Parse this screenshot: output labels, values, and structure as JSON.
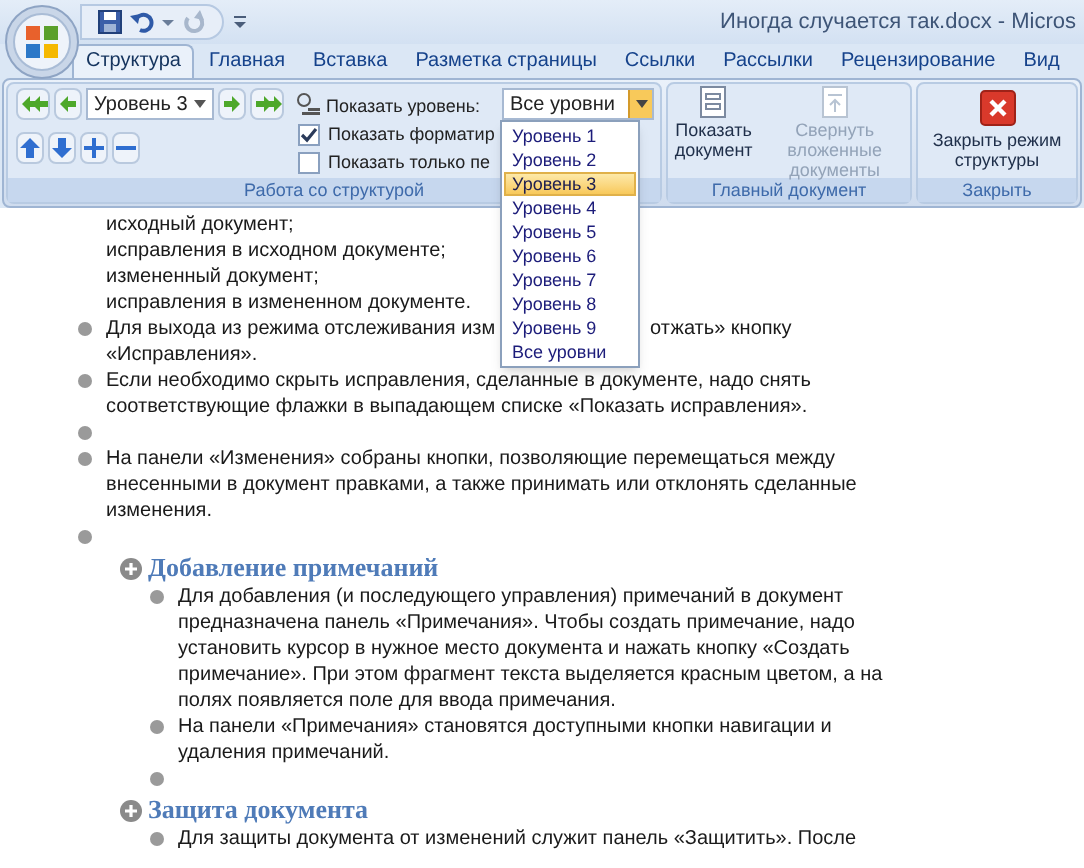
{
  "window": {
    "title": "Иногда случается так.docx - Micros"
  },
  "tabs": [
    {
      "label": "Структура",
      "selected": true
    },
    {
      "label": "Главная",
      "selected": false
    },
    {
      "label": "Вставка",
      "selected": false
    },
    {
      "label": "Разметка страницы",
      "selected": false
    },
    {
      "label": "Ссылки",
      "selected": false
    },
    {
      "label": "Рассылки",
      "selected": false
    },
    {
      "label": "Рецензирование",
      "selected": false
    },
    {
      "label": "Вид",
      "selected": false
    }
  ],
  "outline_group": {
    "label": "Работа со структурой",
    "level_combo": "Уровень 3",
    "show_level_label": "Показать уровень:",
    "show_level_combo": "Все уровни",
    "dropdown_open": true,
    "checkboxes": [
      {
        "label": "Показать форматир",
        "checked": true
      },
      {
        "label": "Показать только пе",
        "checked": false
      }
    ],
    "levels": [
      {
        "label": "Уровень 1",
        "selected": false
      },
      {
        "label": "Уровень 2",
        "selected": false
      },
      {
        "label": "Уровень 3",
        "selected": true
      },
      {
        "label": "Уровень 4",
        "selected": false
      },
      {
        "label": "Уровень 5",
        "selected": false
      },
      {
        "label": "Уровень 6",
        "selected": false
      },
      {
        "label": "Уровень 7",
        "selected": false
      },
      {
        "label": "Уровень 8",
        "selected": false
      },
      {
        "label": "Уровень 9",
        "selected": false
      },
      {
        "label": "Все уровни",
        "selected": false
      }
    ]
  },
  "master_group": {
    "label": "Главный документ",
    "buttons": [
      {
        "label": "Показать документ",
        "disabled": false
      },
      {
        "label": "Свернуть вложенные документы",
        "disabled": true
      }
    ]
  },
  "close_group": {
    "label": "Закрыть",
    "button": "Закрыть режим структуры"
  },
  "document": [
    {
      "kind": "plain",
      "text": "исходный документ;"
    },
    {
      "kind": "plain",
      "text": "исправления в исходном документе;"
    },
    {
      "kind": "plain",
      "text": "измененный документ;"
    },
    {
      "kind": "plain",
      "text": "исправления в измененном документе."
    },
    {
      "kind": "covered",
      "text_left": "Для выхода из режима отслеживания изм",
      "text_right": "отжать» кнопку",
      "text_next": "«Исправления»."
    },
    {
      "kind": "bullet",
      "text": "Если необходимо скрыть исправления, сделанные в документе, надо снять соответствующие флажки в выпадающем списке «Показать исправления»."
    },
    {
      "kind": "bullet"
    },
    {
      "kind": "bullet",
      "text": "На панели «Изменения» собраны кнопки, позволяющие перемещаться между внесенными в документ правками, а также принимать или отклонять сделанные изменения."
    },
    {
      "kind": "bullet"
    },
    {
      "kind": "heading",
      "text": "Добавление примечаний",
      "children": [
        {
          "kind": "bullet",
          "text": "Для добавления (и последующего управления) примечаний в документ предназначена панель «Примечания». Чтобы создать примечание, надо установить курсор в нужное место документа и нажать кнопку «Создать примечание». При этом фрагмент текста выделяется красным цветом, а на полях появляется поле для ввода примечания."
        },
        {
          "kind": "bullet",
          "text": "На панели «Примечания» становятся доступными кнопки навигации и удаления примечаний."
        },
        {
          "kind": "bullet"
        }
      ]
    },
    {
      "kind": "heading",
      "text": "Защита документа",
      "children": [
        {
          "kind": "bullet",
          "text": "Для защиты документа от изменений служит панель «Защитить». После"
        }
      ]
    }
  ]
}
